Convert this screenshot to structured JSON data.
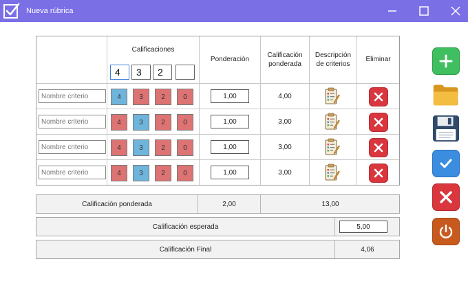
{
  "window": {
    "title": "Nueva rúbrica"
  },
  "table": {
    "headers": {
      "calificaciones": "Calificaciones",
      "ponderacion": "Ponderación",
      "calif_ponderada": "Calificación ponderada",
      "descripcion": "Descripción de criterios",
      "eliminar": "Eliminar"
    },
    "grade_inputs": [
      "4",
      "3",
      "2",
      ""
    ],
    "rows": [
      {
        "name_placeholder": "Nombre criterio",
        "grades": [
          "4",
          "3",
          "2",
          "0"
        ],
        "selected_index": 0,
        "ponderacion": "1,00",
        "calif_ponderada": "4,00"
      },
      {
        "name_placeholder": "Nombre criterio",
        "grades": [
          "4",
          "3",
          "2",
          "0"
        ],
        "selected_index": 1,
        "ponderacion": "1,00",
        "calif_ponderada": "3,00"
      },
      {
        "name_placeholder": "Nombre criterio",
        "grades": [
          "4",
          "3",
          "2",
          "0"
        ],
        "selected_index": 1,
        "ponderacion": "1,00",
        "calif_ponderada": "3,00"
      },
      {
        "name_placeholder": "Nombre criterio",
        "grades": [
          "4",
          "3",
          "2",
          "0"
        ],
        "selected_index": 1,
        "ponderacion": "1,00",
        "calif_ponderada": "3,00"
      }
    ]
  },
  "summary": {
    "ponderada_label": "Calificación ponderada",
    "ponderada_total_pond": "2,00",
    "ponderada_total": "13,00",
    "esperada_label": "Calificación esperada",
    "esperada_value": "5,00",
    "final_label": "Calificación Final",
    "final_value": "4,06"
  },
  "colors": {
    "titlebar": "#7b6fe6",
    "grade_selected": "#6fb4db",
    "grade_unselected": "#dd7373",
    "add": "#3fbf5f",
    "folder": "#f0b73a",
    "save": "#2f4a6a",
    "confirm": "#3b8de0",
    "cancel": "#d9363e",
    "power": "#c85a1e"
  },
  "side_buttons": [
    "plus-icon",
    "folder-icon",
    "save-icon",
    "check-icon",
    "close-icon",
    "power-icon"
  ]
}
